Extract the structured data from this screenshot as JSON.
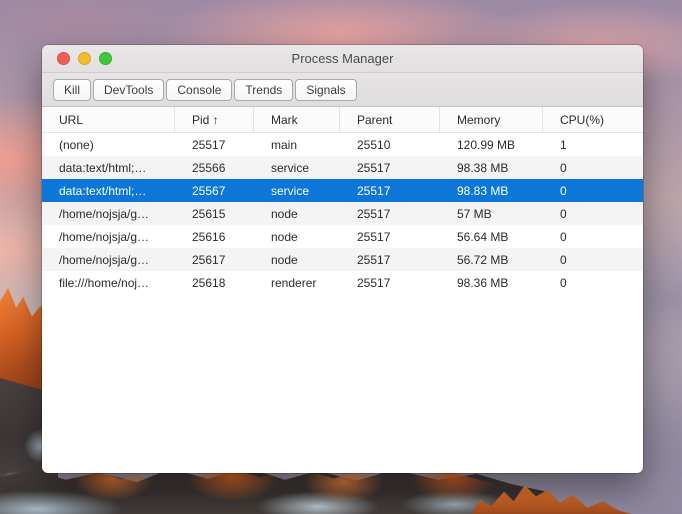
{
  "window": {
    "title": "Process Manager",
    "traffic_lights": {
      "close_color": "#ee6056",
      "minimize_color": "#f3bb2f",
      "zoom_color": "#3fc73e"
    },
    "toolbar": {
      "buttons": [
        "Kill",
        "DevTools",
        "Console",
        "Trends",
        "Signals"
      ]
    },
    "table": {
      "columns": [
        "URL",
        "Pid ↑",
        "Mark",
        "Parent",
        "Memory",
        "CPU(%)"
      ],
      "column_keys": [
        "url",
        "pid",
        "mark",
        "parent",
        "memory",
        "cpu"
      ],
      "sorted_column": "Pid",
      "sort_direction": "ascending",
      "rows": [
        {
          "cells": [
            "(none)",
            "25517",
            "main",
            "25510",
            "120.99 MB",
            "1"
          ],
          "selected": false
        },
        {
          "cells": [
            "data:text/html;…",
            "25566",
            "service",
            "25517",
            "98.38 MB",
            "0"
          ],
          "selected": false
        },
        {
          "cells": [
            "data:text/html;…",
            "25567",
            "service",
            "25517",
            "98.83 MB",
            "0"
          ],
          "selected": true
        },
        {
          "cells": [
            "/home/nojsja/g…",
            "25615",
            "node",
            "25517",
            "57 MB",
            "0"
          ],
          "selected": false
        },
        {
          "cells": [
            "/home/nojsja/g…",
            "25616",
            "node",
            "25517",
            "56.64 MB",
            "0"
          ],
          "selected": false
        },
        {
          "cells": [
            "/home/nojsja/g…",
            "25617",
            "node",
            "25517",
            "56.72 MB",
            "0"
          ],
          "selected": false
        },
        {
          "cells": [
            "file:///home/noj…",
            "25618",
            "renderer",
            "25517",
            "98.36 MB",
            "0"
          ],
          "selected": false
        }
      ]
    },
    "colors": {
      "selection": "#0c77d8",
      "row_stripe": "#f4f4f4"
    }
  }
}
